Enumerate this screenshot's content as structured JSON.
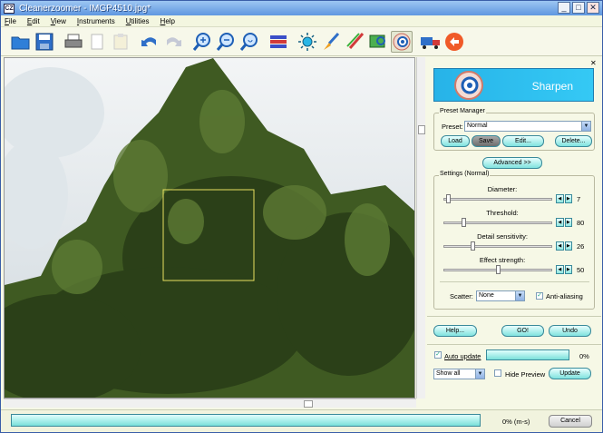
{
  "window": {
    "title": "Cleanerzoomer - IMGP4510.jpg*",
    "app_icon": "CZ"
  },
  "menu": [
    "File",
    "Edit",
    "View",
    "Instruments",
    "Utilities",
    "Help"
  ],
  "toolbar_icons": [
    "open-folder-icon",
    "save-icon",
    "print-icon",
    "copy-icon",
    "paste-icon",
    "undo-icon",
    "redo-icon",
    "zoom-in-icon",
    "zoom-out-icon",
    "zoom-fit-icon",
    "layers-icon",
    "brightness-icon",
    "brush-icon",
    "color-brush-icon",
    "crop-icon",
    "sharpen-icon",
    "truck-icon",
    "back-arrow-icon"
  ],
  "panel": {
    "banner_title": "Sharpen",
    "preset": {
      "group_label": "Preset Manager",
      "label": "Preset:",
      "value": "Normal",
      "load": "Load",
      "save": "Save",
      "edit": "Edit...",
      "delete": "Delete..."
    },
    "advanced": "Advanced >>",
    "settings": {
      "group_label": "Settings (Normal)",
      "sliders": [
        {
          "label": "Diameter:",
          "value": "7",
          "fraction": 0.03
        },
        {
          "label": "Threshold:",
          "value": "80",
          "fraction": 0.17
        },
        {
          "label": "Detail sensitivity:",
          "value": "26",
          "fraction": 0.26
        },
        {
          "label": "Effect strength:",
          "value": "50",
          "fraction": 0.5
        }
      ],
      "scatter_label": "Scatter:",
      "scatter_value": "None",
      "antialias": "Anti-aliasing"
    },
    "help": "Help...",
    "go": "GO!",
    "undo": "Undo",
    "auto_update": "Auto update",
    "auto_pct": "0%",
    "show_all": "Show all",
    "hide_preview": "Hide Preview",
    "update": "Update"
  },
  "status": {
    "text": "0% (m-s)",
    "cancel": "Cancel",
    "progress": 0
  }
}
